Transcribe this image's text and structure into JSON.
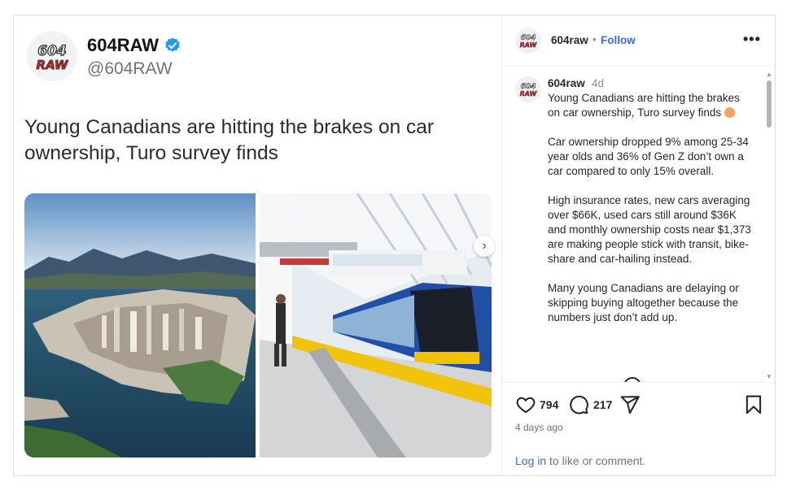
{
  "tweet": {
    "display_name": "604RAW",
    "handle": "@604RAW",
    "headline": "Young Canadians are hitting the brakes on car ownership, Turo survey finds"
  },
  "header": {
    "username": "604raw",
    "separator": "•",
    "follow_label": "Follow",
    "more_label": "•••"
  },
  "caption": {
    "username": "604raw",
    "time": "4d",
    "lead": "Young Canadians are hitting the brakes on car ownership, Turo survey finds",
    "paragraph_2": "Car ownership dropped 9% among 25-34 year olds and 36% of Gen Z don’t own a car compared to only 15% overall.",
    "paragraph_3": "High insurance rates, new cars averaging over $66K, used cars still around $36K and monthly ownership costs near $1,373 are making people stick with transit, bike-share and car-hailing instead.",
    "paragraph_4": "Many young Canadians are delaying or skipping buying altogether because the numbers just don’t add up."
  },
  "actions": {
    "likes": "794",
    "comments": "217"
  },
  "time_ago": "4 days ago",
  "footer": {
    "login_link": "Log in",
    "login_rest": " to like or comment."
  },
  "icons": {
    "verified": "verified-badge-icon",
    "like": "heart-icon",
    "comment": "comment-bubble-icon",
    "share": "paper-plane-icon",
    "save": "bookmark-icon",
    "next": "chevron-right-icon"
  },
  "colors": {
    "accent": "#4169e1",
    "verified": "#1d9bf0",
    "logo_red": "#d92323"
  }
}
